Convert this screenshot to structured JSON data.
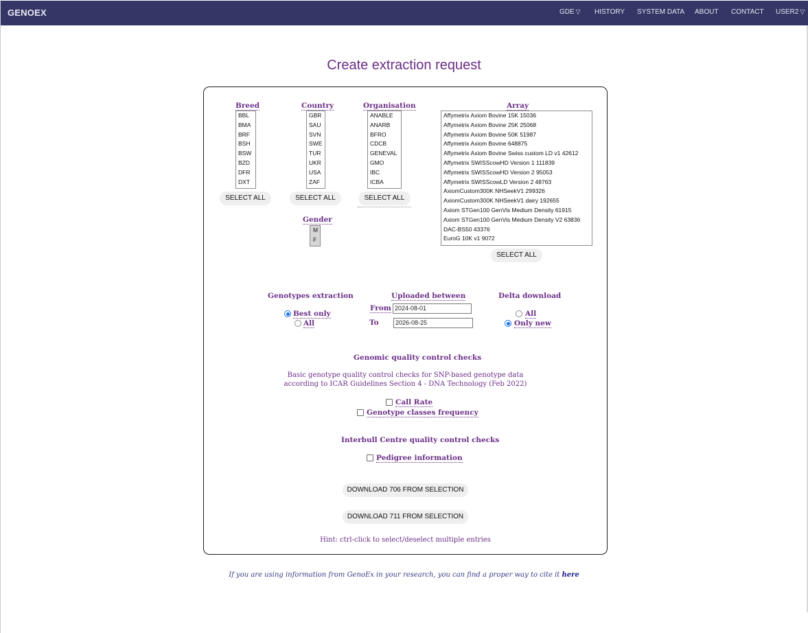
{
  "nav": {
    "brand": "GENOEX",
    "items": [
      {
        "label": "GDE",
        "dropdown": true
      },
      {
        "label": "HISTORY"
      },
      {
        "label": "SYSTEM DATA"
      },
      {
        "label": "ABOUT"
      },
      {
        "label": "CONTACT"
      },
      {
        "label": "USER2",
        "dropdown": true
      }
    ],
    "chevron_icon": "chevron-down-icon"
  },
  "page_title": "Create extraction request",
  "breed": {
    "label": "Breed",
    "options": [
      "BBL",
      "BMA",
      "BRF",
      "BSH",
      "BSW",
      "BZD",
      "DFR",
      "DXT"
    ],
    "select_all": "SELECT ALL"
  },
  "country": {
    "label": "Country",
    "options": [
      "GBR",
      "SAU",
      "SVN",
      "SWE",
      "TUR",
      "UKR",
      "USA",
      "ZAF"
    ],
    "select_all": "SELECT ALL"
  },
  "organisation": {
    "label": "Organisation",
    "options": [
      "ANABLE",
      "ANARB",
      "BFRO",
      "CDCB",
      "GENEVAL",
      "GMO",
      "IBC",
      "ICBA"
    ],
    "select_all": "SELECT ALL"
  },
  "gender": {
    "label": "Gender",
    "options": [
      "M",
      "F"
    ]
  },
  "array": {
    "label": "Array",
    "options": [
      "Affymetrix Axiom Bovine 15K 15036",
      "Affymetrix Axiom Bovine 25K 25068",
      "Affymetrix Axiom Bovine 50K 51987",
      "Affymetrix Axiom Bovine 648875",
      "Affymetrix Axiom Bovine Swiss custom LD v1 42612",
      "Affymetrix SWISScowHD Version 1 111839",
      "Affymetrix SWISScowHD Version 2 95053",
      "Affymetrix SWISScowLD Version 2 48763",
      "AxiomCustom300K NHSeekV1 299326",
      "AxiomCustom300K NHSeekV1 dairy 192655",
      "Axiom STGen100 GenVis Medium Density 61915",
      "Axiom STGen100 GenVis Medium Density V2 63836",
      "DAC-BS50 43376",
      "EuroG 10K v1 9072"
    ],
    "select_all": "SELECT ALL"
  },
  "genotypes": {
    "label": "Genotypes extraction",
    "options": [
      {
        "label": "Best only",
        "checked": true
      },
      {
        "label": "All",
        "checked": false
      }
    ]
  },
  "uploaded": {
    "label": "Uploaded between",
    "from_label": "From",
    "from_value": "2024-08-01",
    "to_label": "To",
    "to_value": "2026-08-25"
  },
  "delta": {
    "label": "Delta download",
    "options": [
      {
        "label": "All",
        "checked": false
      },
      {
        "label": "Only new",
        "checked": true
      }
    ]
  },
  "genomic_qc": {
    "heading": "Genomic quality control checks",
    "desc_line1": "Basic genotype quality control checks for SNP-based genotype data",
    "desc_line2": "according to ICAR Guidelines Section 4 - DNA Technology (Feb 2022)",
    "call_rate": "Call Rate",
    "genotype_classes": "Genotype classes frequency"
  },
  "interbull_qc": {
    "heading": "Interbull Centre quality control checks",
    "pedigree": "Pedigree information"
  },
  "download_selection_1": "DOWNLOAD 706 FROM SELECTION",
  "download_selection_2": "DOWNLOAD 711 FROM SELECTION",
  "hint": "Hint: ctrl-click to select/deselect multiple entries",
  "footer": {
    "text": "If you are using information from GenoEx in your research, you can find a proper way to cite it",
    "link": "here"
  },
  "colors": {
    "navbar": "#343766",
    "accent_purple": "#6a2d86",
    "radio_blue": "#1a73e8"
  }
}
